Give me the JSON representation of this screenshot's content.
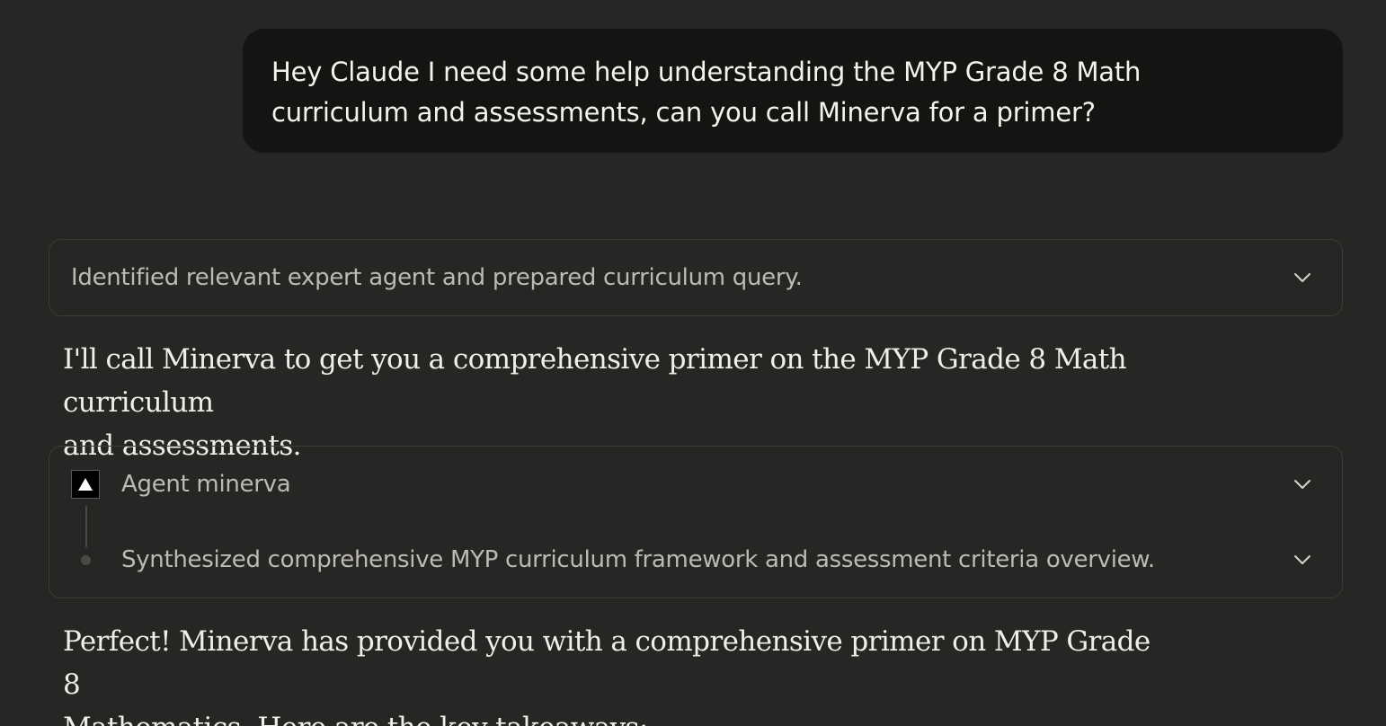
{
  "user_message": {
    "line1": "Hey Claude I need some help understanding the MYP Grade 8 Math",
    "line2": "curriculum and assessments, can you call Minerva for a primer?"
  },
  "thinking": {
    "summary": "Identified relevant expert agent and prepared curriculum query.",
    "icon": "chevron-down-icon"
  },
  "assistant_intro": {
    "line1": "I'll call Minerva to get you a comprehensive primer on the MYP Grade 8 Math curriculum",
    "line2": "and assessments."
  },
  "agent_call": {
    "agent_label": "Agent minerva",
    "step_label": "Synthesized comprehensive MYP curriculum framework and assessment criteria overview.",
    "logo_icon": "triangle-logo-icon",
    "expand_icon": "chevron-down-icon"
  },
  "assistant_followup": {
    "line1": "Perfect! Minerva has provided you with a comprehensive primer on MYP Grade 8",
    "line2": "Mathematics. Here are the key takeaways:"
  },
  "colors": {
    "background": "#262624",
    "user_bubble": "#141413",
    "card_border": "#3d3c39",
    "muted_text": "#bdbab1",
    "body_text": "#f0eee7"
  }
}
